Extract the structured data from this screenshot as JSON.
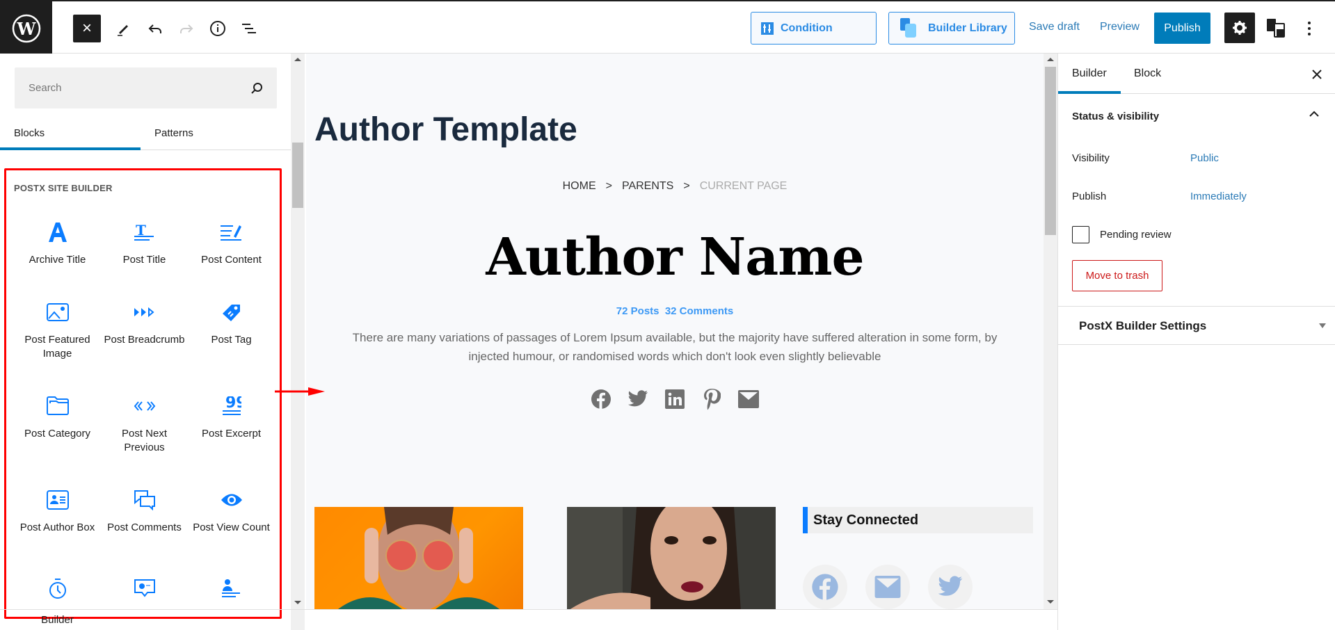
{
  "toolbar": {
    "close_label": "×",
    "condition_label": "Condition",
    "builder_library_label": "Builder Library",
    "save_draft_label": "Save draft",
    "preview_label": "Preview",
    "publish_label": "Publish",
    "icons": [
      "wordpress-logo",
      "close-icon",
      "pencil-icon",
      "undo-icon",
      "redo-icon",
      "info-icon",
      "list-view-icon",
      "condition-icon",
      "builder-library-icon",
      "gear-icon",
      "postx-icon",
      "more-options-icon"
    ]
  },
  "left_panel": {
    "search_placeholder": "Search",
    "tabs": [
      {
        "label": "Blocks",
        "active": true
      },
      {
        "label": "Patterns",
        "active": false
      }
    ],
    "category_title": "POSTX SITE BUILDER",
    "blocks": [
      {
        "label": "Archive Title",
        "icon": "letter-a-icon"
      },
      {
        "label": "Post Title",
        "icon": "title-icon"
      },
      {
        "label": "Post Content",
        "icon": "content-edit-icon"
      },
      {
        "label": "Post Featured Image",
        "icon": "image-icon"
      },
      {
        "label": "Post Breadcrumb",
        "icon": "breadcrumb-icon"
      },
      {
        "label": "Post Tag",
        "icon": "tag-icon"
      },
      {
        "label": "Post Category",
        "icon": "folder-icon"
      },
      {
        "label": "Post Next Previous",
        "icon": "next-prev-icon"
      },
      {
        "label": "Post Excerpt",
        "icon": "quote-icon"
      },
      {
        "label": "Post Author Box",
        "icon": "author-card-icon"
      },
      {
        "label": "Post Comments",
        "icon": "comments-icon"
      },
      {
        "label": "Post View Count",
        "icon": "eye-icon"
      },
      {
        "label": "",
        "icon": "stopwatch-icon"
      },
      {
        "label": "",
        "icon": "chat-bubble-icon"
      },
      {
        "label": "",
        "icon": "author-meta-icon"
      }
    ],
    "cut_off_label": "Builder"
  },
  "canvas": {
    "page_title": "Author Template",
    "breadcrumb": {
      "home": "HOME",
      "separator": ">",
      "parent": "PARENTS",
      "current": "CURRENT PAGE"
    },
    "author_name": "Author Name",
    "author_meta": "72 Posts  32 Comments",
    "author_bio": "There are many variations of passages of Lorem Ipsum available, but the majority have suffered alteration in some form, by injected humour, or randomised words which don't look even slightly believable",
    "author_social": [
      "facebook-icon",
      "twitter-icon",
      "linkedin-icon",
      "pinterest-icon",
      "email-icon"
    ],
    "widget_title": "Stay Connected",
    "widget_social": [
      "facebook-icon",
      "email-icon",
      "twitter-icon"
    ]
  },
  "right_panel": {
    "tabs": [
      {
        "label": "Builder",
        "active": true
      },
      {
        "label": "Block",
        "active": false
      }
    ],
    "status_section_title": "Status & visibility",
    "visibility_label": "Visibility",
    "visibility_value": "Public",
    "publish_label": "Publish",
    "publish_value": "Immediately",
    "pending_review_label": "Pending review",
    "pending_review_checked": false,
    "trash_label": "Move to trash",
    "builder_settings_title": "PostX Builder Settings"
  },
  "colors": {
    "accent": "#007cba",
    "block_icon": "#0a7cff",
    "danger": "#cc1818",
    "annotation": "#ff0000"
  }
}
